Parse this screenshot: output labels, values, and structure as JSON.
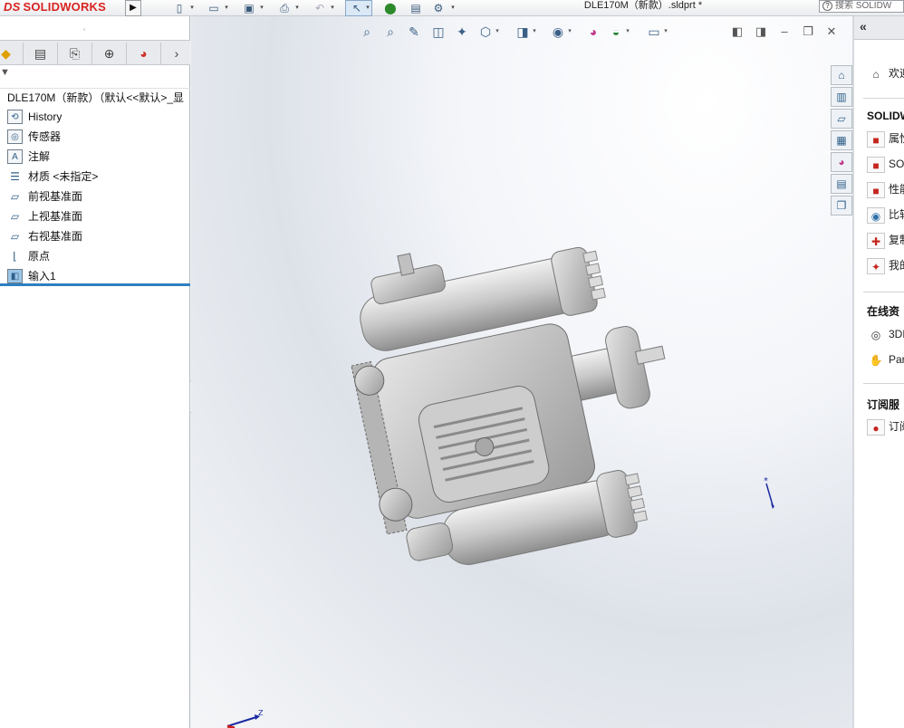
{
  "app": {
    "logo_text": "SOLIDWORKS",
    "logo_prefix": "DS"
  },
  "window": {
    "document_title": "DLE170M（新款）.sldprt *"
  },
  "search": {
    "label": "搜索 SOLIDW"
  },
  "toolbar": {
    "icons": [
      "new-document-icon",
      "open-icon",
      "save-icon",
      "print-icon",
      "undo-icon",
      "select-icon",
      "rebuild-icon",
      "file-properties-icon",
      "options-icon"
    ]
  },
  "feature_tree": {
    "root_label": "DLE170M（新款）（默认<<默认>_显",
    "items": [
      {
        "label": "History",
        "icon": "history-icon"
      },
      {
        "label": "传感器",
        "icon": "sensor-icon"
      },
      {
        "label": "注解",
        "icon": "annotation-icon"
      },
      {
        "label": "材质 <未指定>",
        "icon": "material-icon"
      },
      {
        "label": "前视基准面",
        "icon": "plane-icon"
      },
      {
        "label": "上视基准面",
        "icon": "plane-icon"
      },
      {
        "label": "右视基准面",
        "icon": "plane-icon"
      },
      {
        "label": "原点",
        "icon": "origin-icon"
      },
      {
        "label": "输入1",
        "icon": "imported-body-icon"
      }
    ]
  },
  "triad": {
    "z_label": "Z"
  },
  "task_pane": {
    "welcome": "欢迎",
    "section_solidworks": "SOLIDW",
    "resources": [
      "属性",
      "SOL",
      "性能",
      "比较",
      "复制",
      "我的"
    ],
    "section_online": "在线资",
    "online": [
      "3DE",
      "Par"
    ],
    "section_subscription": "订阅服",
    "subscription": [
      "订阅"
    ]
  },
  "colors": {
    "accent": "#2f7fc0",
    "brand": "#d8231f"
  }
}
